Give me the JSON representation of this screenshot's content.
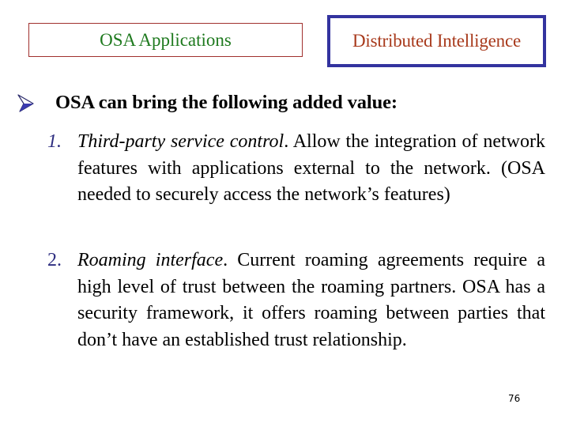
{
  "header": {
    "left_tab": {
      "label": "OSA Applications",
      "border_color": "#a0302e",
      "text_color": "#1f7a1f"
    },
    "right_tab": {
      "label": "Distributed Intelligence",
      "border_color": "#33339f",
      "text_color": "#a83a1c"
    }
  },
  "main": {
    "bullet_icon": "arrowhead-bullet",
    "headline": "OSA can bring the following added value:",
    "items": [
      {
        "number": "1.",
        "title": "Third-party service control",
        "title_suffix": ".",
        "body": " Allow the integration of network features with applications external to the network. (OSA needed to securely access the network’s features)"
      },
      {
        "number": "2.",
        "title": "Roaming interface",
        "title_suffix": ".",
        "body": " Current roaming agreements require a high level of trust between the roaming partners. OSA has a security framework, it offers roaming between parties that don’t have an established trust relationship."
      }
    ]
  },
  "footer": {
    "page_number": "76"
  },
  "colors": {
    "number_color": "#2d2d80",
    "bullet_color": "#3b3bb0"
  }
}
